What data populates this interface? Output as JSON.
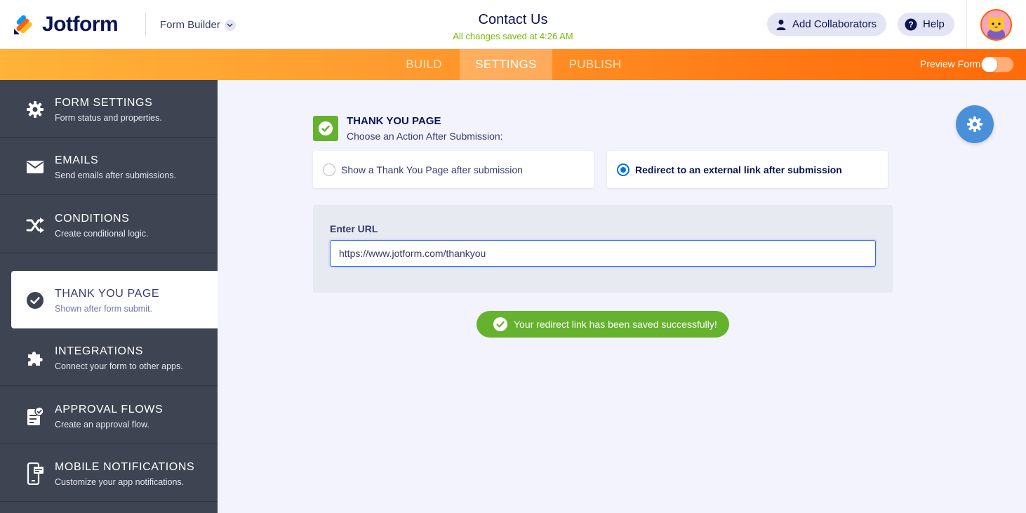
{
  "header": {
    "logo_text": "Jotform",
    "builder_label": "Form Builder",
    "form_title": "Contact Us",
    "saved_status": "All changes saved at 4:26 AM",
    "add_collaborators": "Add Collaborators",
    "help": "Help"
  },
  "tabs": [
    {
      "label": "BUILD",
      "active": false
    },
    {
      "label": "SETTINGS",
      "active": true
    },
    {
      "label": "PUBLISH",
      "active": false
    }
  ],
  "preview": {
    "label": "Preview Form",
    "enabled": false
  },
  "sidebar": {
    "items": [
      {
        "title": "FORM SETTINGS",
        "subtitle": "Form status and properties.",
        "icon": "gear-icon"
      },
      {
        "title": "EMAILS",
        "subtitle": "Send emails after submissions.",
        "icon": "envelope-icon"
      },
      {
        "title": "CONDITIONS",
        "subtitle": "Create conditional logic.",
        "icon": "shuffle-icon"
      },
      {
        "title": "THANK YOU PAGE",
        "subtitle": "Shown after form submit.",
        "icon": "check-circle-icon",
        "active": true
      },
      {
        "title": "INTEGRATIONS",
        "subtitle": "Connect your form to other apps.",
        "icon": "puzzle-icon"
      },
      {
        "title": "APPROVAL FLOWS",
        "subtitle": "Create an approval flow.",
        "icon": "approval-icon"
      },
      {
        "title": "MOBILE NOTIFICATIONS",
        "subtitle": "Customize your app notifications.",
        "icon": "mobile-icon"
      }
    ]
  },
  "main": {
    "section_title": "THANK YOU PAGE",
    "section_subtitle": "Choose an Action After Submission:",
    "options": [
      {
        "label": "Show a Thank You Page after submission",
        "selected": false
      },
      {
        "label": "Redirect to an external link after submission",
        "selected": true
      }
    ],
    "url_label": "Enter URL",
    "url_value": "https://www.jotform.com/thankyou",
    "toast": "Your redirect link has been saved successfully!"
  },
  "colors": {
    "accent_orange": "#ff6100",
    "success_green": "#64b22e",
    "sidebar_bg": "#3e4452",
    "navy": "#0a1551",
    "fab_blue": "#4a90d9"
  }
}
